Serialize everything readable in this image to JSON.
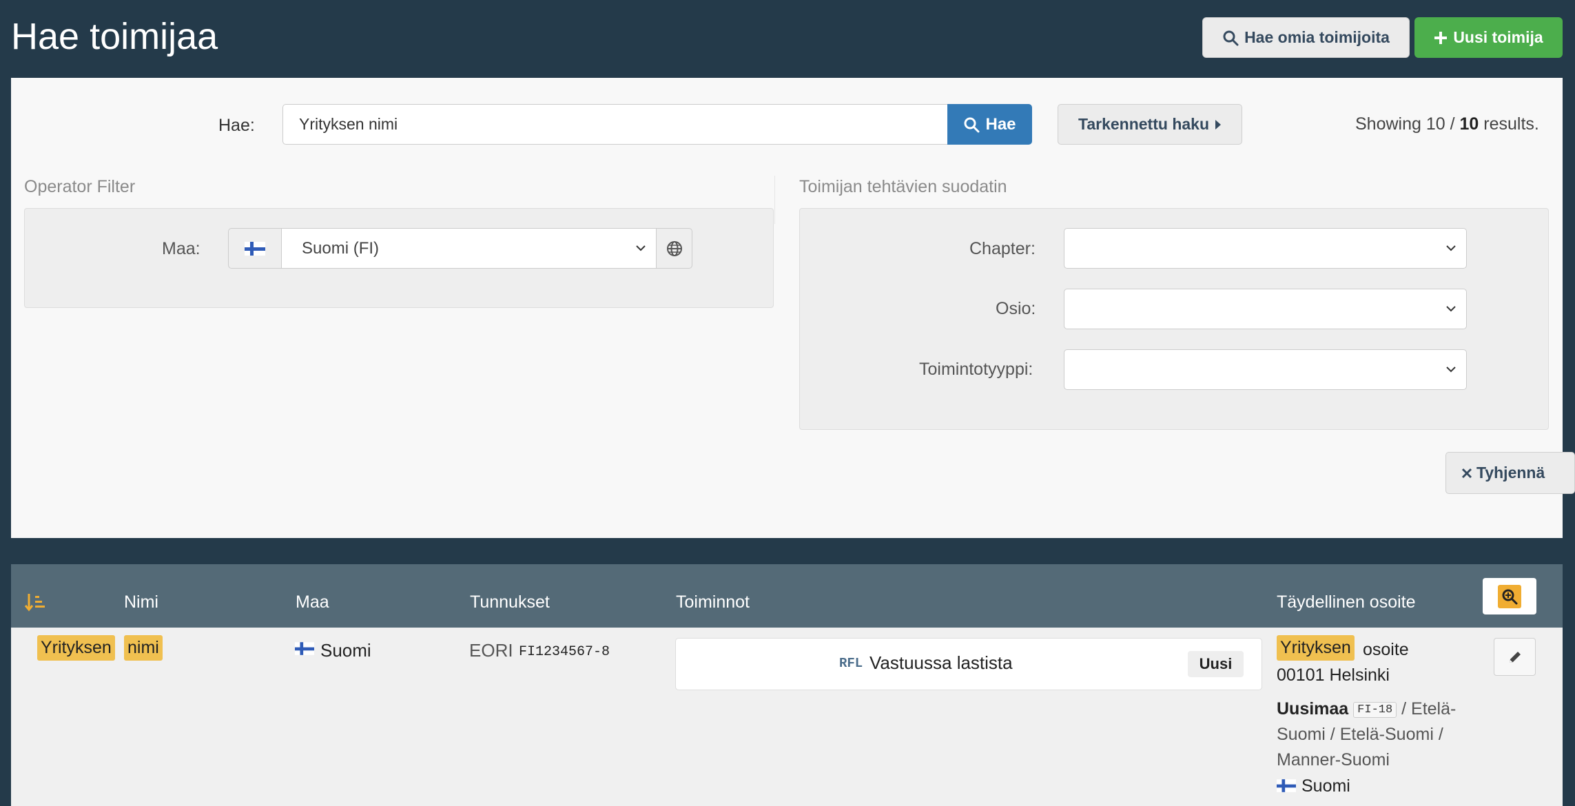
{
  "header": {
    "title": "Hae toimijaa",
    "own_search_label": "Hae omia toimijoita",
    "new_operator_label": "Uusi toimija"
  },
  "search": {
    "label": "Hae:",
    "value": "Yrityksen nimi",
    "button_label": "Hae",
    "advanced_label": "Tarkennettu haku",
    "results_prefix": "Showing 10 / ",
    "results_total": "10",
    "results_suffix": " results."
  },
  "operator_filter": {
    "title": "Operator Filter",
    "country_label": "Maa:",
    "country_value": "Suomi (FI)"
  },
  "task_filter": {
    "title": "Toimijan tehtävien suodatin",
    "chapter_label": "Chapter:",
    "section_label": "Osio:",
    "activity_type_label": "Toimintotyyppi:"
  },
  "clear_label": "Tyhjennä",
  "table": {
    "headers": {
      "name": "Nimi",
      "country": "Maa",
      "identifiers": "Tunnukset",
      "actions": "Toiminnot",
      "address": "Täydellinen osoite"
    },
    "row": {
      "name_parts": [
        "Yrityksen",
        "nimi"
      ],
      "country": "Suomi",
      "id_type": "EORI",
      "id_value": "FI1234567-8",
      "action_code": "RFL",
      "action_name": "Vastuussa lastista",
      "action_status": "Uusi",
      "address_highlight": "Yrityksen",
      "address_rest": "osoite",
      "address_line2": "00101 Helsinki",
      "region_bold": "Uusimaa",
      "region_code": "FI-18",
      "region_line1": " / Etelä-",
      "region_line2": "Suomi / Etelä-Suomi /",
      "region_line3": "Manner-Suomi",
      "address_country": "Suomi"
    }
  },
  "colors": {
    "background": "#243a4a",
    "primary": "#337ab7",
    "success": "#4cae4c",
    "highlight": "#f0c050",
    "table_header": "#546a77"
  }
}
